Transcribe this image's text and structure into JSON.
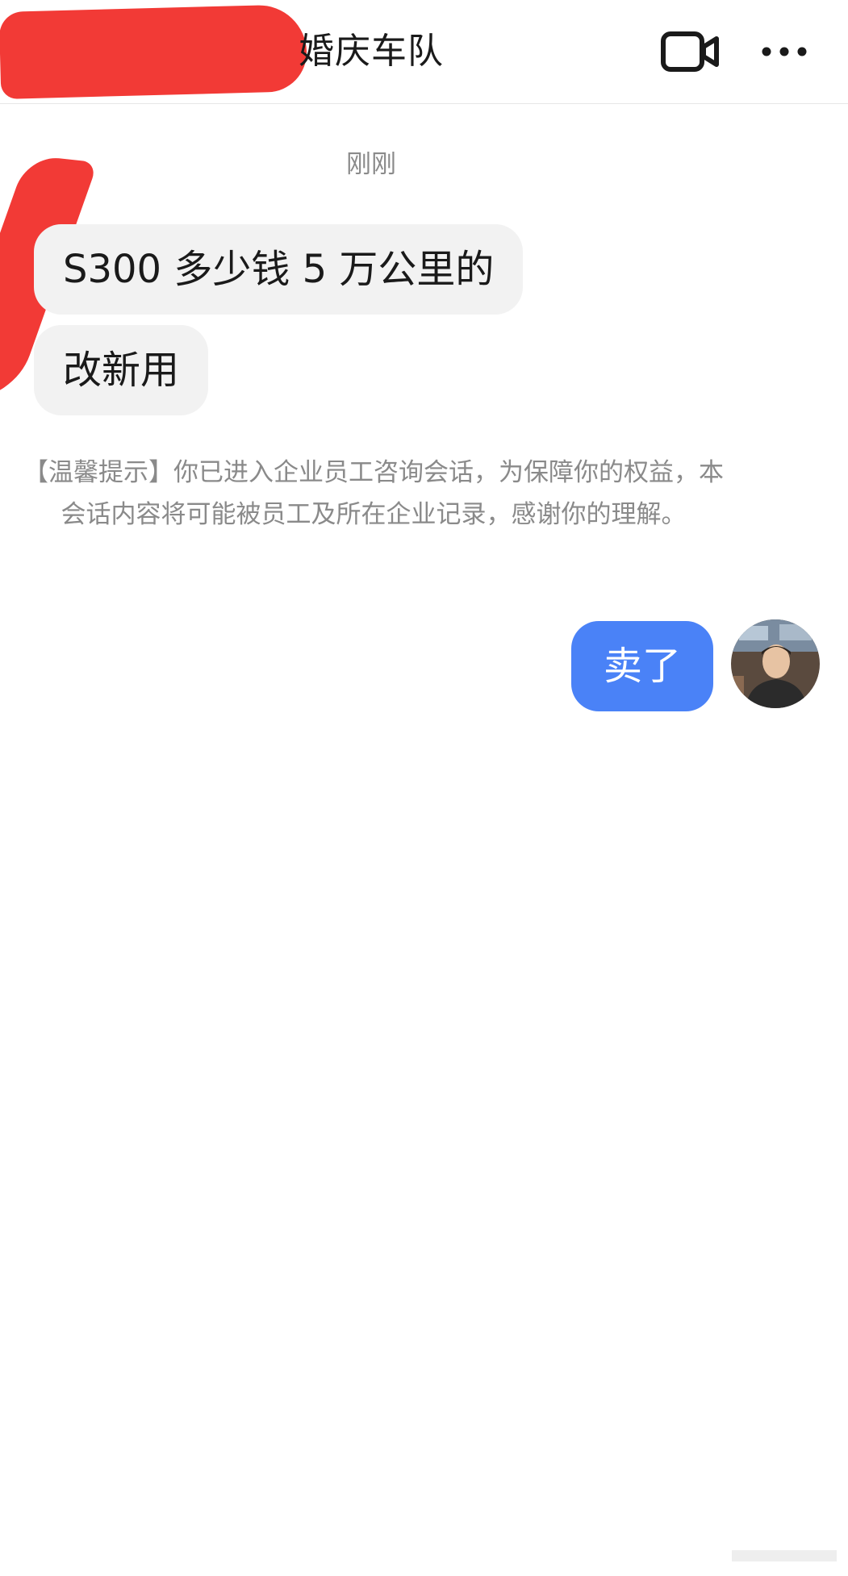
{
  "header": {
    "title": "婚庆车队",
    "video_icon": "video-camera-icon",
    "more_icon": "more-dots-icon"
  },
  "messages": {
    "timestamp": "刚刚",
    "incoming": [
      {
        "text": "S300 多少钱 5 万公里的"
      },
      {
        "text": "改新用"
      }
    ],
    "notice": "【温馨提示】你已进入企业员工咨询会话，为保障你的权益，本会话内容将可能被员工及所在企业记录，感谢你的理解。",
    "outgoing": [
      {
        "text": "卖了"
      }
    ]
  },
  "colors": {
    "accent_bubble": "#4a82f7",
    "incoming_bubble": "#f2f2f2",
    "redaction": "#f23a36",
    "muted_text": "#8a8a8a"
  }
}
